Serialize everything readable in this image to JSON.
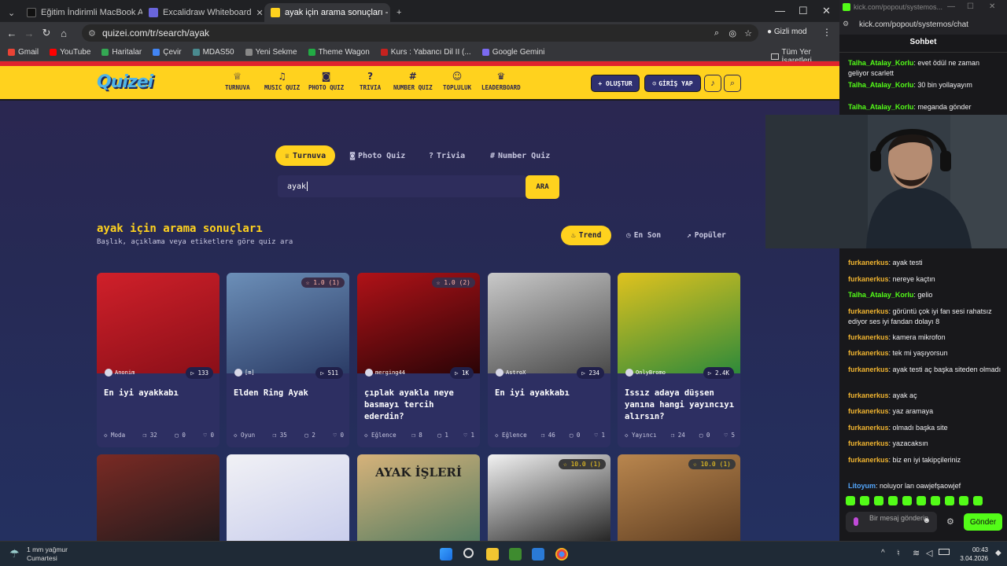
{
  "browser": {
    "tabs": [
      {
        "label": "Eğitim İndirimli MacBook Air M"
      },
      {
        "label": "Excalidraw Whiteboard"
      },
      {
        "label": "ayak için arama sonuçları - Qui"
      }
    ],
    "url": "quizei.com/tr/search/ayak",
    "incognito_label": "Gizli mod",
    "bookmarks": [
      "Gmail",
      "YouTube",
      "Haritalar",
      "Çevir",
      "MDAS50",
      "Yeni Sekme",
      "Theme Wagon",
      "Kurs : Yabancı Dil II (...",
      "Google Gemini"
    ],
    "all_bookmarks": "Tüm Yer İşaretleri"
  },
  "site": {
    "logo": "Quizei",
    "nav": [
      "TURNUVA",
      "MUSIC QUIZ",
      "PHOTO QUIZ",
      "TRIVIA",
      "NUMBER QUIZ",
      "TOPLULUK",
      "LEADERBOARD"
    ],
    "create_label": "+ OLUŞTUR",
    "login_label": "GİRİŞ YAP",
    "mode_tabs": [
      "Turnuva",
      "Photo Quiz",
      "Trivia",
      "Number Quiz"
    ],
    "search_value": "ayak",
    "search_button": "ARA",
    "results_title": "ayak için arama sonuçları",
    "results_subtitle": "Başlık, açıklama veya etiketlere göre quiz ara",
    "sort_tabs": [
      "Trend",
      "En Son",
      "Popüler"
    ],
    "cards": [
      {
        "author": "Anonim",
        "plays": "133",
        "rating": "",
        "title": "En iyi ayakkabı",
        "category": "Moda",
        "questions": "32",
        "comments": "0",
        "likes": "0",
        "color1": "#d0202a",
        "color2": "#8a0f18"
      },
      {
        "author": "[m]",
        "plays": "511",
        "rating": "1.0 (1)",
        "title": "Elden Ring Ayak",
        "category": "Oyun",
        "questions": "35",
        "comments": "2",
        "likes": "0",
        "color1": "#6c8fb8",
        "color2": "#2b3c66"
      },
      {
        "author": "merging44",
        "plays": "1K",
        "rating": "1.0 (2)",
        "title": "çıplak ayakla neye basmayı tercih ederdin?",
        "category": "Eğlence",
        "questions": "8",
        "comments": "1",
        "likes": "1",
        "color1": "#b01218",
        "color2": "#2a0406"
      },
      {
        "author": "AstroX",
        "plays": "234",
        "rating": "",
        "title": "En iyi ayakkabı",
        "category": "Eğlence",
        "questions": "46",
        "comments": "0",
        "likes": "1",
        "color1": "#c9c9c9",
        "color2": "#4a4a4a"
      },
      {
        "author": "OnlyBromo",
        "plays": "2.4K",
        "rating": "",
        "title": "Issız adaya düşsen yanına hangi yayıncıyı alırsın?",
        "category": "Yayıncı",
        "questions": "24",
        "comments": "0",
        "likes": "5",
        "color1": "#e0c21e",
        "color2": "#2e8a3a"
      }
    ],
    "row2": [
      {
        "rating": "",
        "color1": "#7a2a24",
        "color2": "#1d1a1c"
      },
      {
        "rating": "",
        "color1": "#f1f1f5",
        "color2": "#c7ccec"
      },
      {
        "rating": "",
        "text": "AYAK İŞLERİ",
        "color1": "#d6b27a",
        "color2": "#4e7a60"
      },
      {
        "rating": "10.0 (1)",
        "color1": "#f2f2f2",
        "color2": "#1a1a1a"
      },
      {
        "rating": "10.0 (1)",
        "color1": "#b9864e",
        "color2": "#5a3a1f"
      }
    ]
  },
  "chat": {
    "url": "kick.com/popout/systemos/chat",
    "url_small": "kick.com/popout/systemos...",
    "title": "Sohbet",
    "messages_top": [
      {
        "user": "Talha_Atalay_Korlu",
        "text": "evet ödül ne zaman geliyor scarlett",
        "color": "#53fc18"
      },
      {
        "user": "Talha_Atalay_Korlu",
        "text": "30 bin yollayayım",
        "color": "#53fc18"
      },
      {
        "user": "Talha_Atalay_Korlu",
        "text": "meganda gönder",
        "color": "#53fc18"
      }
    ],
    "messages": [
      {
        "user": "furkanerkus",
        "text": "ayak testi",
        "color": "#f0b430"
      },
      {
        "user": "furkanerkus",
        "text": "nereye kaçtın",
        "color": "#f0b430"
      },
      {
        "user": "Talha_Atalay_Korlu",
        "text": "gelio",
        "color": "#53fc18"
      },
      {
        "user": "furkanerkus",
        "text": "görüntü çok iyi fan sesi rahatsız ediyor ses iyi fandan dolayı 8",
        "color": "#f0b430"
      },
      {
        "user": "furkanerkus",
        "text": "kamera mikrofon",
        "color": "#f0b430"
      },
      {
        "user": "furkanerkus",
        "text": "tek mi yaşıyorsun",
        "color": "#f0b430"
      },
      {
        "user": "furkanerkus",
        "text": "ayak testi aç başka siteden olmadı",
        "color": "#f0b430"
      },
      {
        "user": "furkanerkus",
        "text": "ayak aç",
        "color": "#f0b430"
      },
      {
        "user": "furkanerkus",
        "text": "yaz aramaya",
        "color": "#f0b430"
      },
      {
        "user": "furkanerkus",
        "text": "olmadı başka site",
        "color": "#f0b430"
      },
      {
        "user": "furkanerkus",
        "text": "yazacaksın",
        "color": "#f0b430"
      },
      {
        "user": "furkanerkus",
        "text": "biz en iyi takipçileriniz",
        "color": "#f0b430"
      },
      {
        "user": "Litoyum",
        "text": "noluyor lan oawjefşaowjef",
        "color": "#53a6fc"
      }
    ],
    "input_placeholder": "Bir mesaj gönderin",
    "send_label": "Gönder"
  },
  "taskbar": {
    "weather_line1": "1 mm yağmur",
    "weather_line2": "Cumartesi",
    "time": "00:43",
    "date": "3.04.2026"
  }
}
